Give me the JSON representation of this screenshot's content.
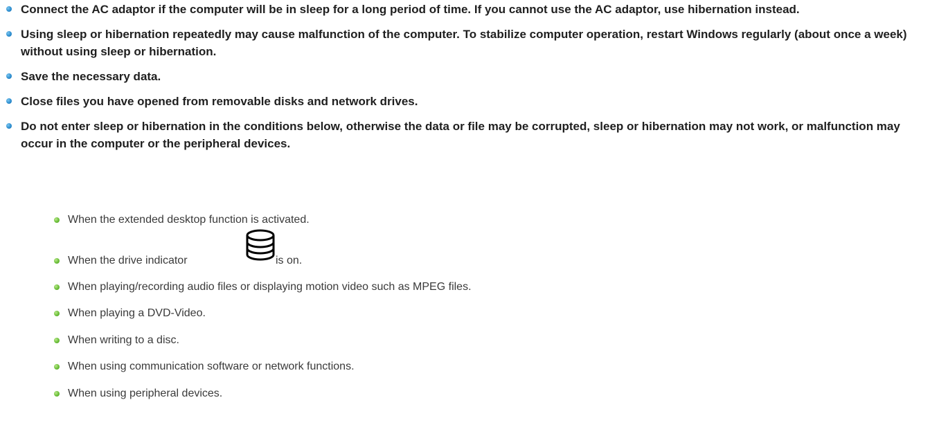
{
  "notes": [
    "Connect the AC adaptor if the computer will be in sleep for a long period of time. If you cannot use the AC adaptor, use hibernation instead.",
    "Using sleep or hibernation repeatedly may cause malfunction of the computer. To stabilize computer operation, restart Windows regularly (about once a week) without using sleep or hibernation.",
    "Save the necessary data.",
    "Close files you have opened from removable disks and network drives.",
    "Do not enter sleep or hibernation in the conditions below, otherwise the data or file may be corrupted, sleep or hibernation may not work, or malfunction may occur in the computer or the peripheral devices."
  ],
  "conditions": {
    "extended_desktop": "When the extended desktop function is activated.",
    "drive_indicator_before": "When the drive indicator",
    "drive_indicator_icon": "drive-indicator-icon",
    "drive_indicator_after": "is on.",
    "audio_video": "When playing/recording audio files or displaying motion video such as MPEG files.",
    "dvd": "When playing a DVD-Video.",
    "disc": "When writing to a disc.",
    "communication": "When using communication software or network functions.",
    "peripheral": "When using peripheral devices."
  },
  "colors": {
    "primary_bullet": "#2f8fd0",
    "secondary_bullet": "#6cbf3a",
    "text": "#1f1f1f"
  }
}
